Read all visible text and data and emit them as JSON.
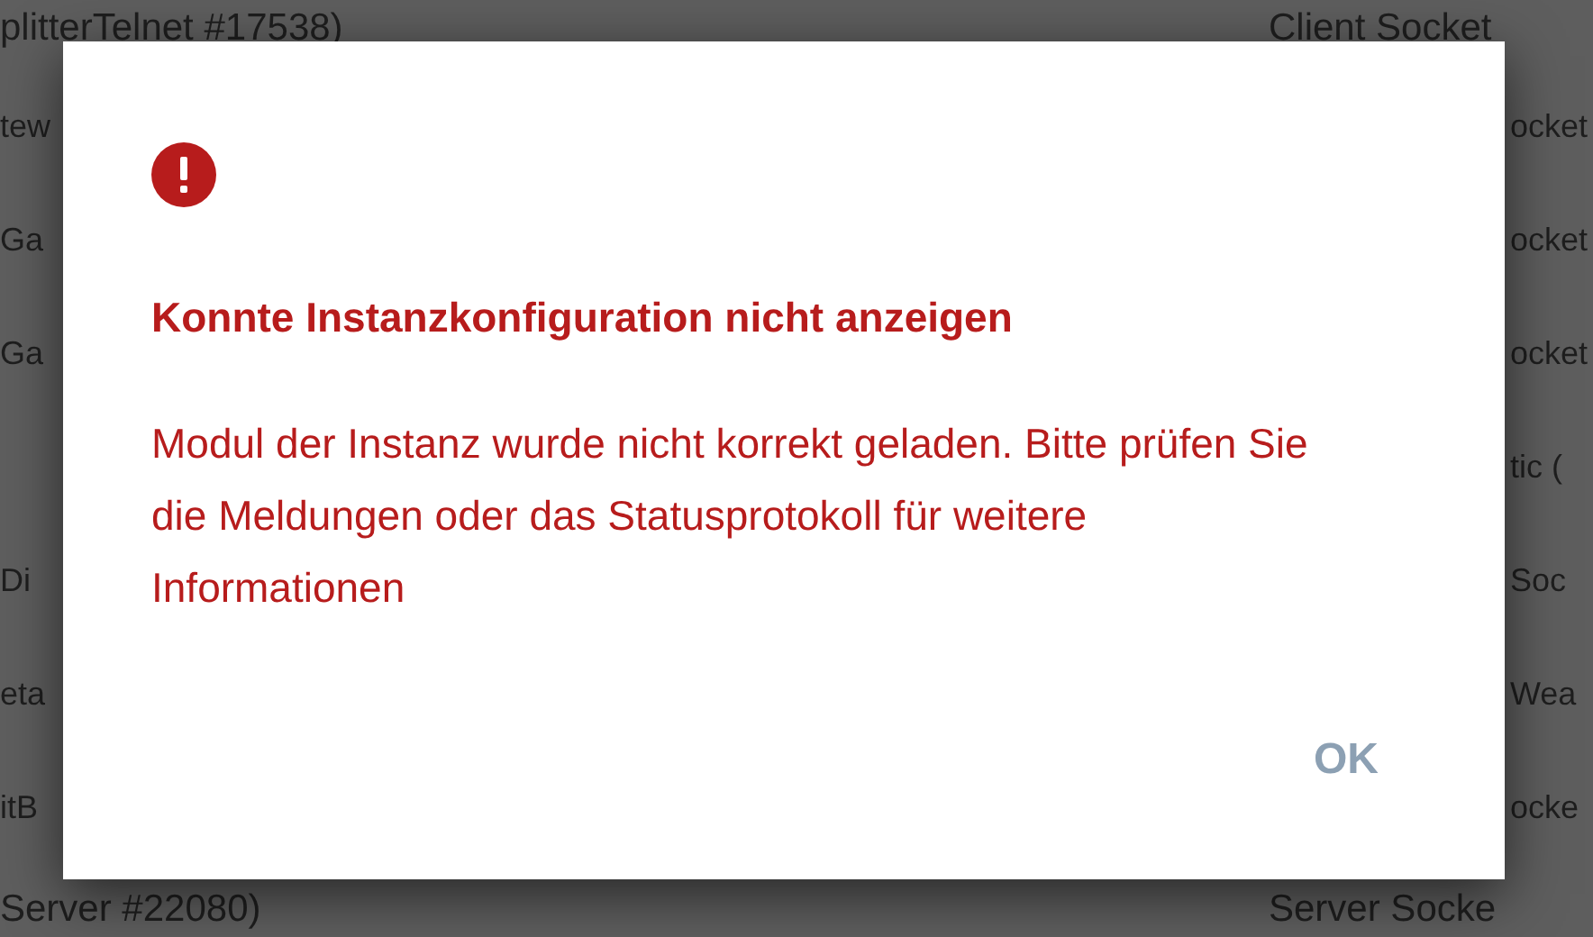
{
  "background_rows": [
    {
      "column_1": "plitterTelnet #17538)",
      "column_2": "Client Socket"
    },
    {
      "column_1": "tew",
      "column_2": "ocket"
    },
    {
      "column_1": "Ga",
      "column_2": "ocket"
    },
    {
      "column_1": "Ga",
      "column_2": "ocket"
    },
    {
      "column_2": "tic ("
    },
    {
      "column_1": "Di",
      "column_2": "Soc"
    },
    {
      "column_1": "eta",
      "column_2": "Wea"
    },
    {
      "column_1": "itB",
      "column_2": "ocke"
    },
    {
      "column_1": "Server #22080)",
      "column_2": "Server Socke"
    }
  ],
  "dialog": {
    "title": "Konnte Instanzkonfiguration nicht anzeigen",
    "message": "Modul der Instanz wurde nicht korrekt geladen. Bitte prüfen Sie die Meldungen oder das Statusprotokoll für weitere Informationen",
    "buttons": [
      "OK"
    ]
  }
}
